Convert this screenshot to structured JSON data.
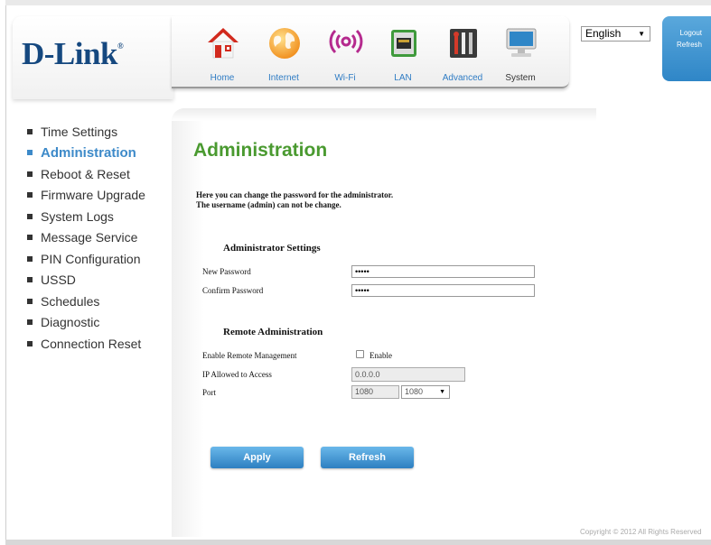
{
  "header": {
    "logo": "D-Link",
    "logo_mark": "®",
    "nav": [
      {
        "label": "Home",
        "icon": "home-icon"
      },
      {
        "label": "Internet",
        "icon": "globe-icon"
      },
      {
        "label": "Wi-Fi",
        "icon": "wifi-icon"
      },
      {
        "label": "LAN",
        "icon": "lan-port-icon"
      },
      {
        "label": "Advanced",
        "icon": "tools-icon"
      },
      {
        "label": "System",
        "icon": "monitor-icon"
      }
    ],
    "language": "English",
    "logout": "Logout",
    "refresh": "Refresh"
  },
  "sidebar": {
    "items": [
      {
        "label": "Time Settings"
      },
      {
        "label": "Administration"
      },
      {
        "label": "Reboot & Reset"
      },
      {
        "label": "Firmware Upgrade"
      },
      {
        "label": "System Logs"
      },
      {
        "label": "Message Service"
      },
      {
        "label": "PIN Configuration"
      },
      {
        "label": "USSD"
      },
      {
        "label": "Schedules"
      },
      {
        "label": "Diagnostic"
      },
      {
        "label": "Connection Reset"
      }
    ],
    "active_index": 1
  },
  "main": {
    "title": "Administration",
    "description_line1": "Here you can change the password for the administrator.",
    "description_line2": "The username (admin) can not be change.",
    "admin_settings": {
      "title": "Administrator Settings",
      "new_password_label": "New Password",
      "new_password_value": "•••••",
      "confirm_password_label": "Confirm Password",
      "confirm_password_value": "•••••"
    },
    "remote_admin": {
      "title": "Remote Administration",
      "enable_label": "Enable Remote Management",
      "enable_checkbox_label": "Enable",
      "enabled": false,
      "ip_label": "IP Allowed to Access",
      "ip_value": "0.0.0.0",
      "port_label": "Port",
      "port_value": "1080",
      "port_select": "1080"
    },
    "apply_label": "Apply",
    "refresh_label": "Refresh"
  },
  "footer": {
    "copyright": "Copyright © 2012  All Rights Reserved"
  },
  "colors": {
    "accent_blue": "#2f86c7",
    "title_green": "#4a9a30",
    "logo_navy": "#15487f"
  }
}
